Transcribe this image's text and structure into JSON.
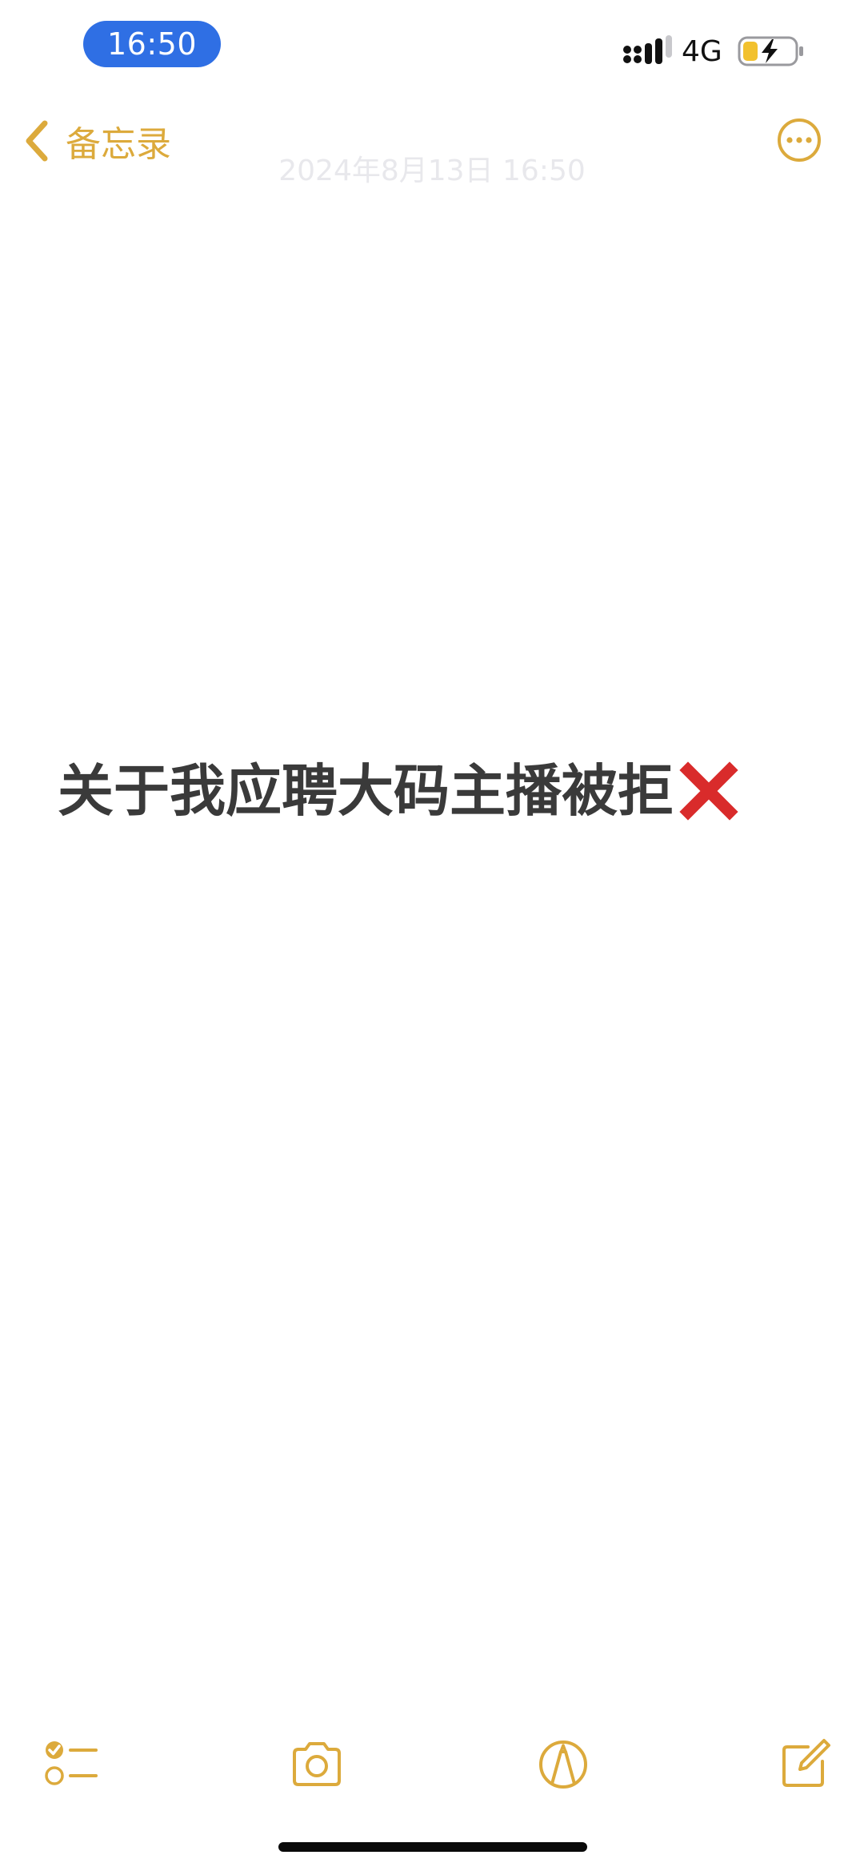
{
  "status_bar": {
    "time": "16:50",
    "network": "4G"
  },
  "nav": {
    "back_label": "备忘录"
  },
  "note": {
    "date": "2024年8月13日 16:50",
    "text": "关于我应聘大码主播被拒"
  },
  "icons": {
    "back": "chevron-left-icon",
    "more": "ellipsis-circle-icon",
    "checklist": "checklist-icon",
    "camera": "camera-icon",
    "markup": "markup-pen-icon",
    "compose": "compose-icon",
    "reject_mark": "cross-mark-icon"
  },
  "colors": {
    "accent": "#dcaa3c",
    "time_pill": "#2f6fe4",
    "reject_mark": "#d92b2b"
  }
}
